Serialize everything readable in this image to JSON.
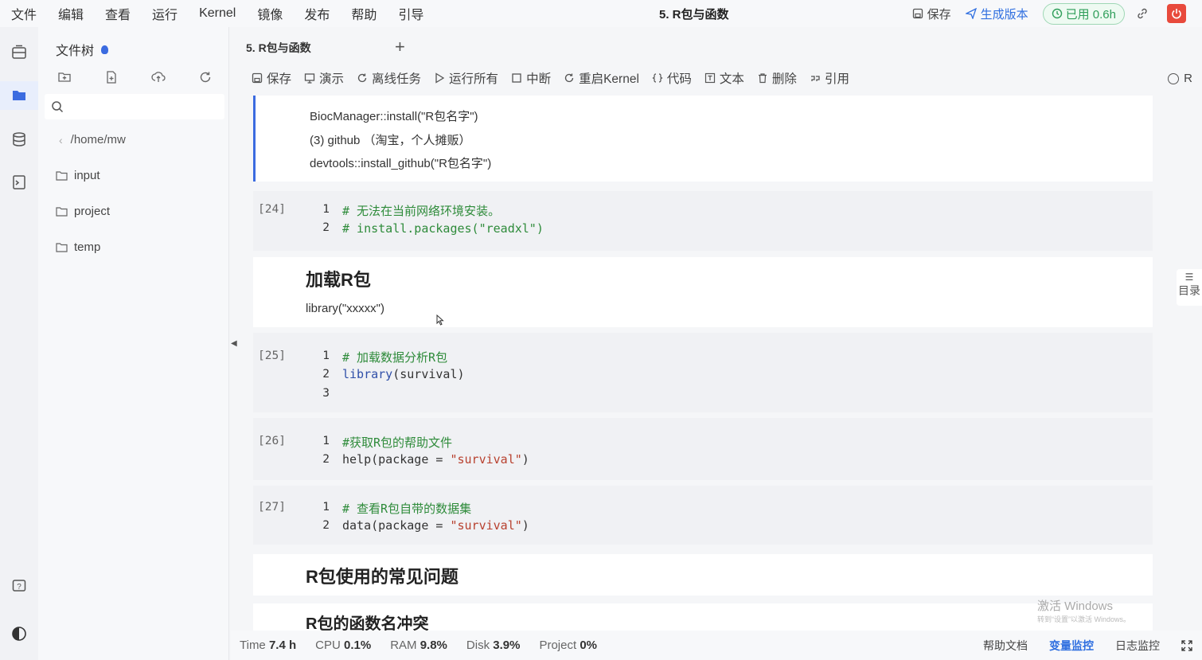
{
  "menu": [
    "文件",
    "编辑",
    "查看",
    "运行",
    "Kernel",
    "镜像",
    "发布",
    "帮助",
    "引导"
  ],
  "doc_title": "5. R包与函数",
  "top_right": {
    "save_label": "保存",
    "generate_label": "生成版本",
    "usage_label": "已用 0.6h"
  },
  "filetree": {
    "title": "文件树",
    "search_placeholder": "",
    "path": "/home/mw",
    "items": [
      "input",
      "project",
      "temp"
    ]
  },
  "tab": {
    "label": "5. R包与函数"
  },
  "toolbar": {
    "save": "保存",
    "present": "演示",
    "offline": "离线任务",
    "run_all": "运行所有",
    "interrupt": "中断",
    "restart": "重启Kernel",
    "code": "代码",
    "text": "文本",
    "delete": "删除",
    "cite": "引用",
    "kernel_label": "R"
  },
  "cells": {
    "md1": {
      "lines": [
        "BiocManager::install(\"R包名字\")",
        "(3) github （淘宝，个人摊贩）",
        "devtools::install_github(\"R包名字\")"
      ]
    },
    "c24": {
      "prompt": "[24]",
      "l1": "# 无法在当前网络环境安装。",
      "l2": "# install.packages(\"readxl\")"
    },
    "md2": {
      "heading": "加载R包",
      "line": "library(\"xxxxx\")"
    },
    "c25": {
      "prompt": "[25]",
      "l1": "# 加载数据分析R包",
      "l2_fn": "library",
      "l2_rest": "(survival)"
    },
    "c26": {
      "prompt": "[26]",
      "l1": "#获取R包的帮助文件",
      "l2_pre": "help(package = ",
      "l2_str": "\"survival\"",
      "l2_post": ")"
    },
    "c27": {
      "prompt": "[27]",
      "l1": "# 查看R包自带的数据集",
      "l2_pre": "data(package = ",
      "l2_str": "\"survival\"",
      "l2_post": ")"
    },
    "md3": {
      "heading": "R包使用的常见问题"
    },
    "md4": {
      "heading": "R包的函数名冲突"
    }
  },
  "status": {
    "time_label": "Time",
    "time_value": "7.4 h",
    "cpu_label": "CPU",
    "cpu_value": "0.1%",
    "ram_label": "RAM",
    "ram_value": "9.8%",
    "disk_label": "Disk",
    "disk_value": "3.9%",
    "project_label": "Project",
    "project_value": "0%",
    "help_docs": "帮助文档",
    "var_monitor": "变量监控",
    "log_monitor": "日志监控"
  },
  "toc_label": "目录",
  "activate_windows": "激活 Windows",
  "activate_windows_sub": "转到“设置”以激活 Windows。",
  "colors": {
    "accent": "#3b6be0",
    "comment": "#2e8b3a",
    "string": "#b8412f",
    "usage": "#2f9e5a",
    "power": "#e84a3c"
  }
}
